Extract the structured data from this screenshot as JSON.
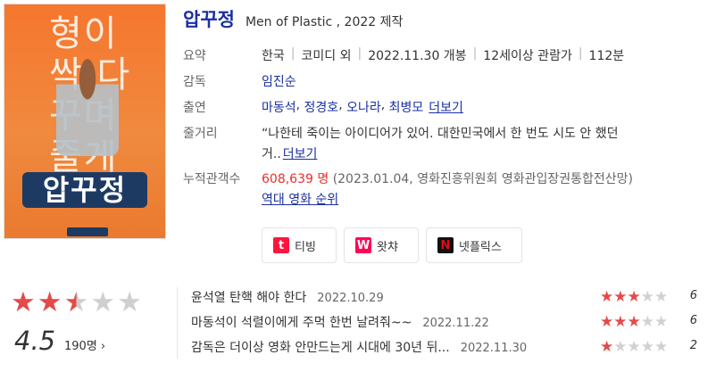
{
  "movie": {
    "title": "압꾸정",
    "subtitle": "Men of Plastic , 2022 제작",
    "poster": {
      "big_text": "형이 싹 다 꾸며 줄게",
      "logo_text": "압꾸정"
    }
  },
  "info": {
    "summary_label": "요약",
    "country": "한국",
    "genre": "코미디 외",
    "release": "2022.11.30 개봉",
    "rating": "12세이상 관람가",
    "runtime": "112분",
    "director_label": "감독",
    "director": "임진순",
    "cast_label": "출연",
    "cast": [
      "마동석",
      "정경호",
      "오나라",
      "최병모"
    ],
    "cast_more": "더보기",
    "plot_label": "줄거리",
    "plot_line1": "“나한테 죽이는 아이디어가 있어. 대한민국에서 한 번도 시도 안 했던",
    "plot_line2": "거..",
    "plot_more": "더보기",
    "audience_label": "누적관객수",
    "audience_count": "608,639 명",
    "audience_source": "(2023.01.04, 영화진흥위원회 영화관입장권통합전산망)",
    "ranking_link": "역대 영화 순위"
  },
  "ott": [
    {
      "name": "티빙",
      "icon": "tving-icon",
      "color": "#ff143c",
      "letter": "t"
    },
    {
      "name": "왓챠",
      "icon": "watcha-icon",
      "color": "#ff0558",
      "letter": "W"
    },
    {
      "name": "넷플릭스",
      "icon": "netflix-icon",
      "color": "#e50914",
      "letter": "N"
    }
  ],
  "rating": {
    "score": "4.5",
    "stars": 2.5,
    "count": "190명",
    "count_chevron": "›"
  },
  "reviews": [
    {
      "text": "윤석열 탄핵 해야 한다",
      "date": "2022.10.29",
      "stars": 3,
      "score": "6"
    },
    {
      "text": "마동석이 석렬이에게 주먹 한번 날려줘~~",
      "date": "2022.11.22",
      "stars": 3,
      "score": "6"
    },
    {
      "text": "감독은 더이상 영화 안만드는게 시대에 30년 뒤...",
      "date": "2022.11.30",
      "stars": 1,
      "score": "2"
    }
  ]
}
